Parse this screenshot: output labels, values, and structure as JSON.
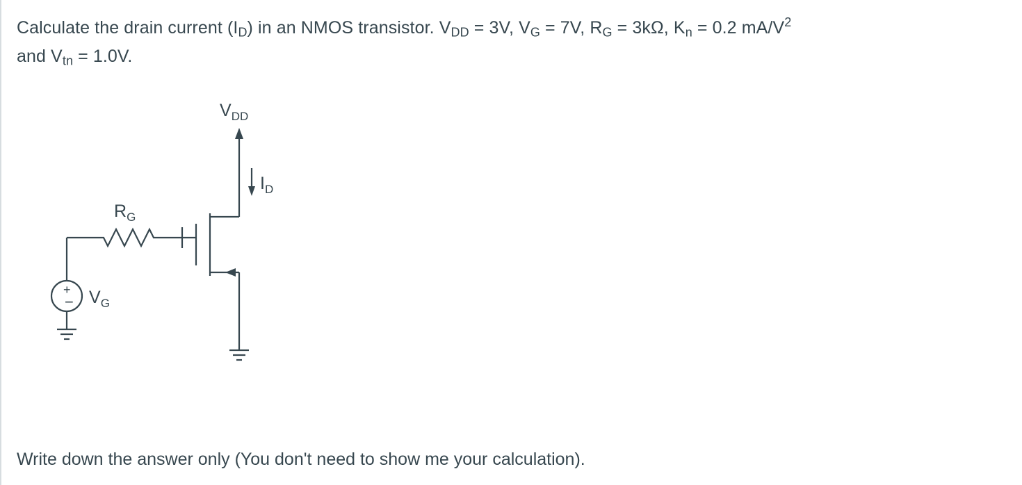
{
  "question": {
    "line1_prefix": "Calculate the drain current (I",
    "line1_sub_id": "D",
    "line1_mid1": ") in an NMOS transistor. V",
    "line1_sub_vdd": "DD",
    "line1_eq_vdd": " = 3V, V",
    "line1_sub_vg": "G",
    "line1_eq_vg": " = 7V, R",
    "line1_sub_rg": "G",
    "line1_eq_rg": " = 3kΩ, K",
    "line1_sub_kn": "n",
    "line1_eq_kn": " = 0.2 mA/V",
    "line1_sup_sq": "2",
    "line2_prefix": "and V",
    "line2_sub_vtn": "tn",
    "line2_eq_vtn": " = 1.0V."
  },
  "labels": {
    "vdd_main": "V",
    "vdd_sub": "DD",
    "id_main": "I",
    "id_sub": "D",
    "rg_main": "R",
    "rg_sub": "G",
    "vg_main": "V",
    "vg_sub": "G"
  },
  "footer": "Write down the answer only (You don't need to show me your calculation)."
}
